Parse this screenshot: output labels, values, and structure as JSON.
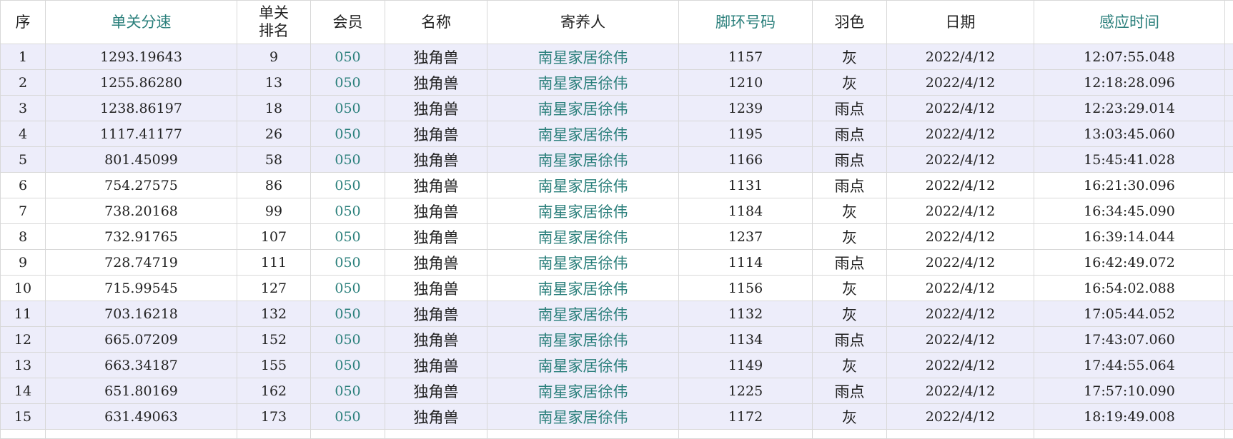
{
  "headers": [
    {
      "key": "seq",
      "label": "序",
      "teal": false
    },
    {
      "key": "speed",
      "label": "单关分速",
      "teal": true
    },
    {
      "key": "rank",
      "label": "单关\n排名",
      "teal": false
    },
    {
      "key": "member",
      "label": "会员",
      "teal": false
    },
    {
      "key": "name",
      "label": "名称",
      "teal": false
    },
    {
      "key": "owner",
      "label": "寄养人",
      "teal": false
    },
    {
      "key": "ring",
      "label": "脚环号码",
      "teal": true
    },
    {
      "key": "color",
      "label": "羽色",
      "teal": false
    },
    {
      "key": "date",
      "label": "日期",
      "teal": false
    },
    {
      "key": "time",
      "label": "感应时间",
      "teal": true
    }
  ],
  "rows": [
    {
      "seq": "1",
      "speed": "1293.19643",
      "rank": "9",
      "member": "050",
      "name": "独角兽",
      "owner": "南星家居徐伟",
      "ring": "1157",
      "color": "灰",
      "date": "2022/4/12",
      "time": "12:07:55.048"
    },
    {
      "seq": "2",
      "speed": "1255.86280",
      "rank": "13",
      "member": "050",
      "name": "独角兽",
      "owner": "南星家居徐伟",
      "ring": "1210",
      "color": "灰",
      "date": "2022/4/12",
      "time": "12:18:28.096"
    },
    {
      "seq": "3",
      "speed": "1238.86197",
      "rank": "18",
      "member": "050",
      "name": "独角兽",
      "owner": "南星家居徐伟",
      "ring": "1239",
      "color": "雨点",
      "date": "2022/4/12",
      "time": "12:23:29.014"
    },
    {
      "seq": "4",
      "speed": "1117.41177",
      "rank": "26",
      "member": "050",
      "name": "独角兽",
      "owner": "南星家居徐伟",
      "ring": "1195",
      "color": "雨点",
      "date": "2022/4/12",
      "time": "13:03:45.060"
    },
    {
      "seq": "5",
      "speed": "801.45099",
      "rank": "58",
      "member": "050",
      "name": "独角兽",
      "owner": "南星家居徐伟",
      "ring": "1166",
      "color": "雨点",
      "date": "2022/4/12",
      "time": "15:45:41.028"
    },
    {
      "seq": "6",
      "speed": "754.27575",
      "rank": "86",
      "member": "050",
      "name": "独角兽",
      "owner": "南星家居徐伟",
      "ring": "1131",
      "color": "雨点",
      "date": "2022/4/12",
      "time": "16:21:30.096"
    },
    {
      "seq": "7",
      "speed": "738.20168",
      "rank": "99",
      "member": "050",
      "name": "独角兽",
      "owner": "南星家居徐伟",
      "ring": "1184",
      "color": "灰",
      "date": "2022/4/12",
      "time": "16:34:45.090"
    },
    {
      "seq": "8",
      "speed": "732.91765",
      "rank": "107",
      "member": "050",
      "name": "独角兽",
      "owner": "南星家居徐伟",
      "ring": "1237",
      "color": "灰",
      "date": "2022/4/12",
      "time": "16:39:14.044"
    },
    {
      "seq": "9",
      "speed": "728.74719",
      "rank": "111",
      "member": "050",
      "name": "独角兽",
      "owner": "南星家居徐伟",
      "ring": "1114",
      "color": "雨点",
      "date": "2022/4/12",
      "time": "16:42:49.072"
    },
    {
      "seq": "10",
      "speed": "715.99545",
      "rank": "127",
      "member": "050",
      "name": "独角兽",
      "owner": "南星家居徐伟",
      "ring": "1156",
      "color": "灰",
      "date": "2022/4/12",
      "time": "16:54:02.088"
    },
    {
      "seq": "11",
      "speed": "703.16218",
      "rank": "132",
      "member": "050",
      "name": "独角兽",
      "owner": "南星家居徐伟",
      "ring": "1132",
      "color": "灰",
      "date": "2022/4/12",
      "time": "17:05:44.052"
    },
    {
      "seq": "12",
      "speed": "665.07209",
      "rank": "152",
      "member": "050",
      "name": "独角兽",
      "owner": "南星家居徐伟",
      "ring": "1134",
      "color": "雨点",
      "date": "2022/4/12",
      "time": "17:43:07.060"
    },
    {
      "seq": "13",
      "speed": "663.34187",
      "rank": "155",
      "member": "050",
      "name": "独角兽",
      "owner": "南星家居徐伟",
      "ring": "1149",
      "color": "灰",
      "date": "2022/4/12",
      "time": "17:44:55.064"
    },
    {
      "seq": "14",
      "speed": "651.80169",
      "rank": "162",
      "member": "050",
      "name": "独角兽",
      "owner": "南星家居徐伟",
      "ring": "1225",
      "color": "雨点",
      "date": "2022/4/12",
      "time": "17:57:10.090"
    },
    {
      "seq": "15",
      "speed": "631.49063",
      "rank": "173",
      "member": "050",
      "name": "独角兽",
      "owner": "南星家居徐伟",
      "ring": "1172",
      "color": "灰",
      "date": "2022/4/12",
      "time": "18:19:49.008"
    }
  ],
  "shaded_rows": [
    1,
    2,
    3,
    4,
    5,
    11,
    12,
    13,
    14,
    15
  ],
  "colors": {
    "teal": "#2a7f7b",
    "shade": "#ededfa",
    "grid": "#d8d8d8"
  }
}
